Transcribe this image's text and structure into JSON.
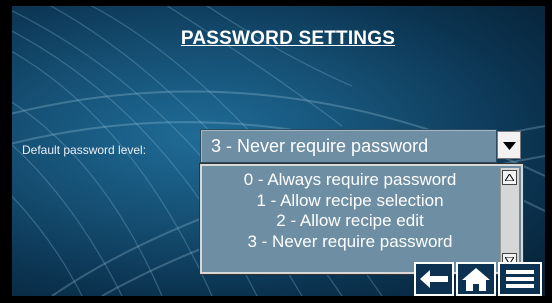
{
  "screen": {
    "title": "PASSWORD SETTINGS"
  },
  "password_setting": {
    "label": "Default password level:",
    "selected_value": "3 - Never require password",
    "options": [
      "0 - Always require password",
      "1 - Allow recipe selection",
      "2 - Allow recipe edit",
      "3 - Never require password"
    ]
  },
  "icons": {
    "dropdown": "chevron-down-icon",
    "scroll_up": "scroll-up-icon",
    "scroll_down": "scroll-down-icon",
    "back": "back-arrow-icon",
    "home": "home-icon",
    "menu": "menu-icon"
  },
  "colors": {
    "background": "#154f73",
    "field_fill": "#6d8ea3",
    "text": "#ffffff",
    "nav_border": "#ffffff"
  }
}
